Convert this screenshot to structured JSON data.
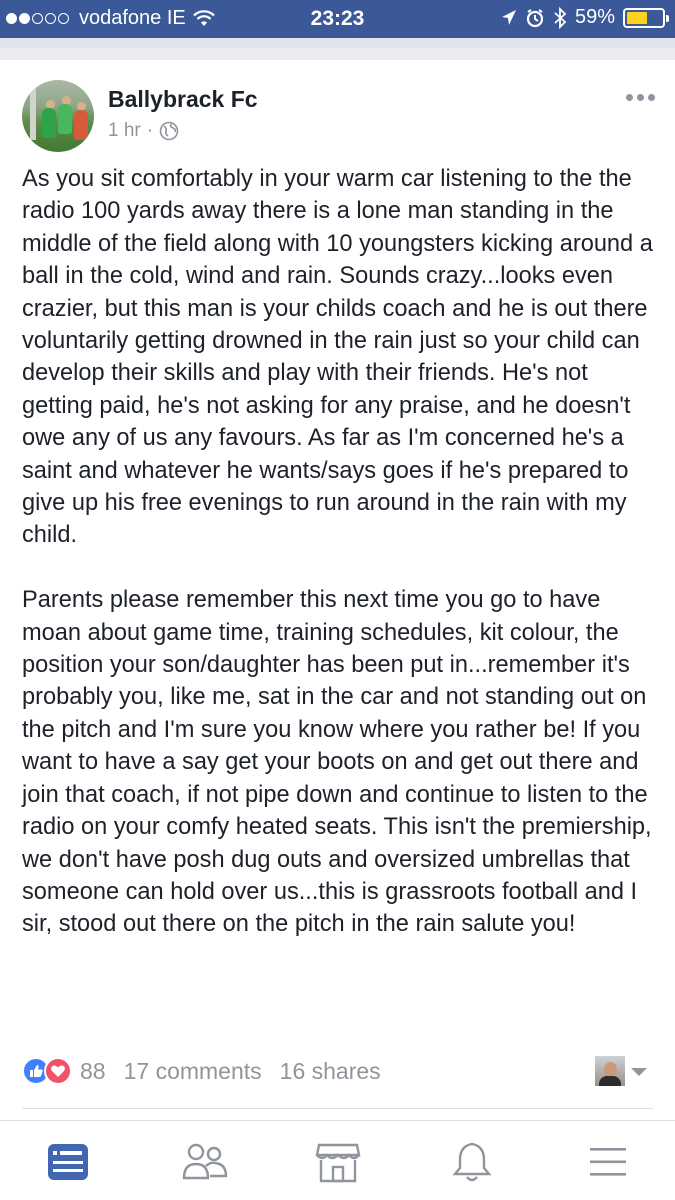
{
  "status_bar": {
    "carrier": "vodafone IE",
    "time": "23:23",
    "battery_percent": "59%",
    "battery_level": 0.59,
    "icons": [
      "signal-dots-icon",
      "wifi-icon",
      "location-arrow-icon",
      "alarm-icon",
      "bluetooth-icon",
      "battery-icon"
    ],
    "background_color": "#3b5998"
  },
  "post": {
    "author": "Ballybrack Fc",
    "timestamp": "1 hr",
    "separator": "·",
    "privacy_icon": "globe-icon",
    "more_icon": "more-dots-icon",
    "paragraphs": [
      "As you sit comfortably in your warm car listening to the the radio 100 yards away there is a lone man standing in the middle of the field along with 10 youngsters kicking around a ball in the cold, wind and rain. Sounds crazy...looks even crazier, but this man is your childs coach and he is out there voluntarily getting drowned in the rain just so your child can develop their skills and play with their friends. He's not getting paid, he's not asking for any praise, and he doesn't owe any of us any favours. As far as I'm concerned he's a saint and whatever he wants/says goes if he's prepared to give up his free evenings to run around in the rain with my child.",
      "Parents please remember this next time you go to have moan about game time, training schedules, kit colour, the position your son/daughter has been put in...remember it's probably you, like me, sat in the car and not standing out on the pitch and I'm sure you know where you rather be! If you want to have a say get your boots on and get out there and join that coach, if not pipe down and continue to listen to the radio on your comfy heated seats. This isn't the premiership, we don't have posh dug outs and oversized umbrellas that someone can hold over us...this is grassroots football and I sir, stood out there on the pitch in the rain salute you!"
    ],
    "reactions": {
      "icons": [
        "like-reaction-icon",
        "love-reaction-icon"
      ],
      "count": "88",
      "comments": "17 comments",
      "shares": "16 shares",
      "like_color": "#4080ff",
      "love_color": "#f25268"
    }
  },
  "tab_bar": {
    "tabs": [
      {
        "name": "news-feed",
        "icon": "news-feed-icon",
        "active": true
      },
      {
        "name": "friends",
        "icon": "friends-icon",
        "active": false
      },
      {
        "name": "marketplace",
        "icon": "marketplace-icon",
        "active": false
      },
      {
        "name": "notifications",
        "icon": "bell-icon",
        "active": false
      },
      {
        "name": "menu",
        "icon": "hamburger-menu-icon",
        "active": false
      }
    ],
    "active_color": "#4267b2",
    "inactive_color": "#90949c"
  }
}
